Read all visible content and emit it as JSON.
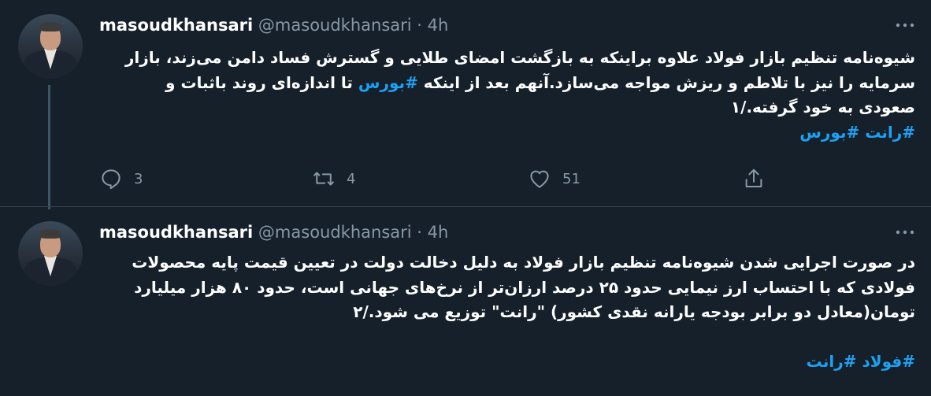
{
  "tweets": [
    {
      "name": "masoudkhansari",
      "handle": "@masoudkhansari",
      "dot": "·",
      "time": "4h",
      "lines": [
        "شیوه‌نامه تنظیم بازار فولاد علاوه براینکه به بازگشت امضای طلایی و گسترش فساد دامن می‌زند، بازار",
        "سرمایه را نیز با تلاطم و ریزش مواجه می‌سازد.آنهم بعد از اینکه",
        "تا اندازه‌ای روند باثبات و",
        "صعودی به خود گرفته./۱"
      ],
      "inline_hashtag": "#بورس",
      "hashtags": [
        "#رانت",
        "#بورس"
      ],
      "stats": {
        "replies": "3",
        "retweets": "4",
        "likes": "51"
      }
    },
    {
      "name": "masoudkhansari",
      "handle": "@masoudkhansari",
      "dot": "·",
      "time": "4h",
      "lines": [
        "در صورت اجرایی شدن شیوه‌نامه تنظیم بازار فولاد به دلیل دخالت دولت در تعیین قیمت پایه محصولات",
        "فولادی که با احتساب ارز نیمایی حدود ۲۵ درصد ارزان‌تر از نرخ‌های جهانی است، حدود ۸۰ هزار میلیارد",
        "تومان(معادل دو برابر بودجه یارانه نقدی کشور) \"رانت\" توزیع می شود./۲"
      ],
      "hashtags": [
        "#فولاد",
        "#رانت"
      ]
    }
  ],
  "icons": {
    "avatar": "profile-photo",
    "more": "more-options-icon",
    "reply": "reply-icon",
    "retweet": "retweet-icon",
    "like": "heart-icon",
    "share": "share-icon"
  },
  "colors": {
    "background": "#15202b",
    "text": "#ffffff",
    "muted": "#8899a6",
    "accent": "#1da1f2",
    "divider": "#38444d"
  }
}
